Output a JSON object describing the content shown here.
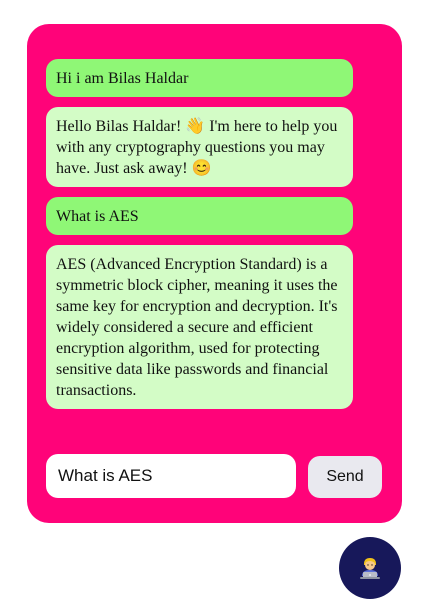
{
  "chat": {
    "messages": [
      {
        "role": "user",
        "text": "Hi i am Bilas Haldar"
      },
      {
        "role": "bot",
        "text": "Hello Bilas Haldar! 👋 I'm here to help you with any cryptography questions you may have. Just ask away! 😊"
      },
      {
        "role": "user",
        "text": "What is AES"
      },
      {
        "role": "bot",
        "text": "AES (Advanced Encryption Standard) is a symmetric block cipher, meaning it uses the same key for encryption and decryption. It's widely considered a secure and efficient encryption algorithm, used for protecting sensitive data like passwords and financial transactions."
      }
    ]
  },
  "input": {
    "value": "What is AES"
  },
  "send_label": "Send",
  "launcher": {
    "icon": "technologist-avatar-icon"
  },
  "colors": {
    "panel": "#ff0379",
    "user_bubble": "#8ff776",
    "bot_bubble": "#d3fcc6",
    "input_bg": "#ffffff",
    "send_button": "#e9e9ef",
    "launcher": "#17185a"
  }
}
